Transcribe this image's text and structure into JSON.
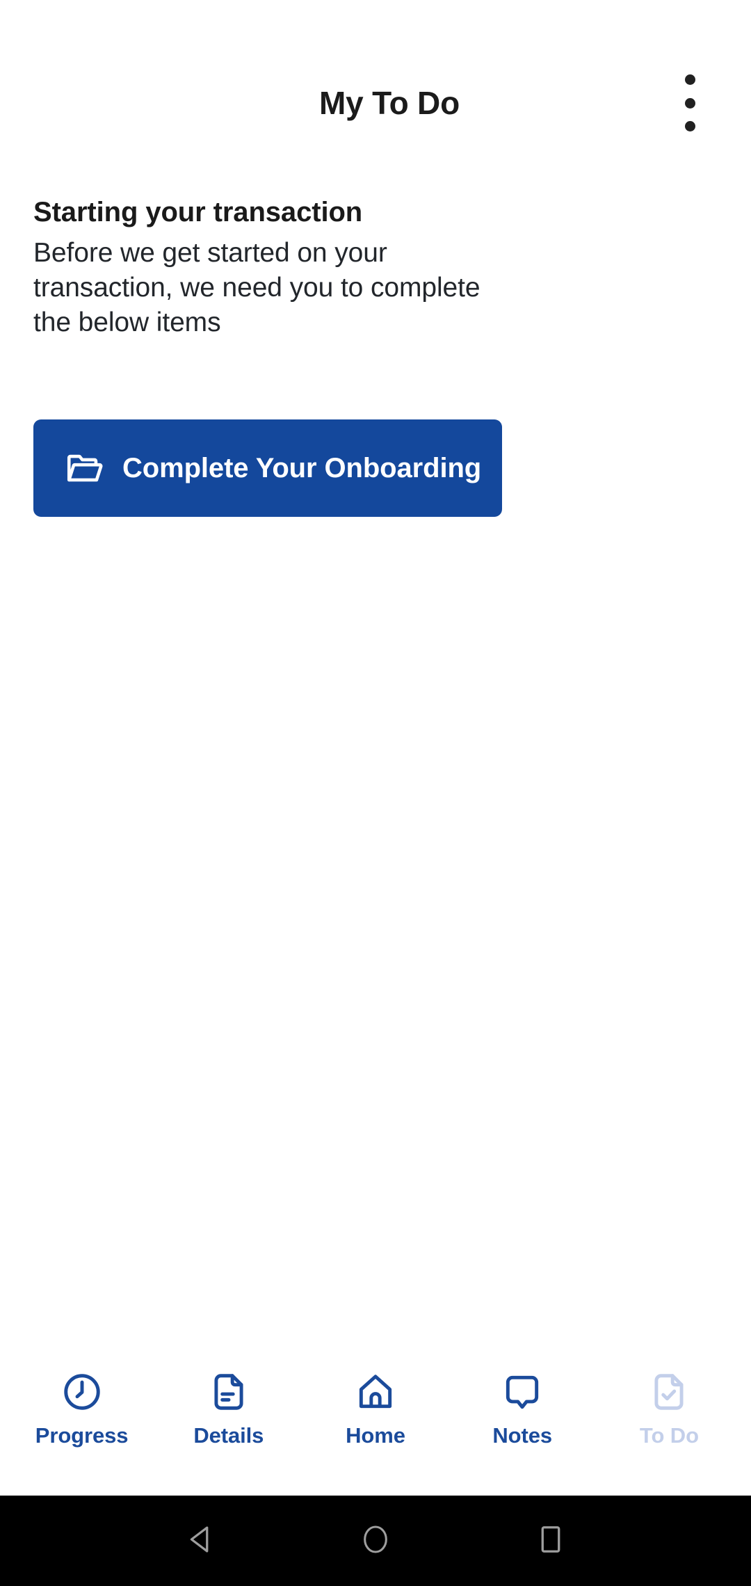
{
  "appbar": {
    "title": "My To Do",
    "overflow_menu_name": "more-options"
  },
  "content": {
    "heading": "Starting your transaction",
    "body": "Before we get started on your transaction, we need you to complete the below items",
    "primary_action": {
      "label": "Complete Your Onboarding",
      "icon": "folder-open-icon",
      "background_color": "#14489C",
      "text_color": "#FFFFFF"
    }
  },
  "tabbar": {
    "active_color": "#1B4B9B",
    "current_color": "#C3CFEA",
    "items": [
      {
        "label": "Progress",
        "icon": "clock-icon",
        "current": false
      },
      {
        "label": "Details",
        "icon": "document-lines-icon",
        "current": false
      },
      {
        "label": "Home",
        "icon": "home-icon",
        "current": false
      },
      {
        "label": "Notes",
        "icon": "speech-bubble-icon",
        "current": false
      },
      {
        "label": "To Do",
        "icon": "document-check-icon",
        "current": true
      }
    ]
  },
  "system_nav": {
    "background_color": "#000000",
    "icon_color": "#9E9E9E",
    "buttons": [
      {
        "name": "back",
        "icon": "triangle-left-icon"
      },
      {
        "name": "home",
        "icon": "circle-icon"
      },
      {
        "name": "recents",
        "icon": "square-icon"
      }
    ]
  }
}
